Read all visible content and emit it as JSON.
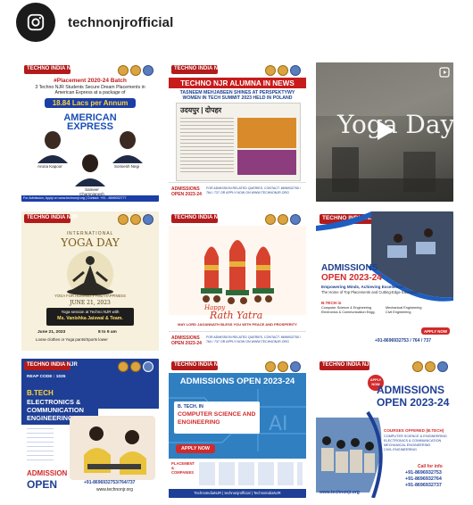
{
  "profile": {
    "handle": "technonjrofficial"
  },
  "posts": [
    {
      "id": "placement",
      "logo": "TECHNO INDIA NJR",
      "headline": "#Placement 2020-24 Batch",
      "subline": "3 Techno NJR Students Secure Dream Placements in American Express at a package of",
      "package": "18.84 Lacs per Annum",
      "company_line1": "AMERICAN",
      "company_line2": "EXPRESS",
      "students": [
        "Aruna Kapoor",
        "Somiesh Negi",
        "Sameer Chamnjanesh"
      ],
      "footer": "For Admission, Apply on www.technonjr.org | Contact: +91 - 8696932777"
    },
    {
      "id": "alumna-news",
      "logo": "TECHNO INDIA NJR",
      "banner": "TECHNO NJR ALUMNA IN NEWS",
      "headline": "TASNEEM MEHJABEEN SHINES AT PERSPEKTYWY WOMEN IN TECH SUMMIT 2023 HELD IN POLAND",
      "paper": "उदयपुर | दोपहर",
      "footer_left": "ADMISSIONS OPEN 2023-24",
      "footer_right": "FOR ADMISSION RELATED QUERIES, CONTACT: 8696932755 / 764 / 737 OR APPLY NOW ON WWW.TECHNONJR.ORG"
    },
    {
      "id": "yoga-video",
      "title": "Yoga Day"
    },
    {
      "id": "yoga-day",
      "logo": "TECHNO INDIA NJR",
      "title_top": "INTERNATIONAL",
      "title": "YOGA DAY",
      "tagline": "YOGA FOR HUMANITY AND HAPPINESS",
      "date_line": "JUNE 21, 2023",
      "session": "Yoga session at Techno NJR with",
      "instructor": "Ms. Vanishka Jaiswal & Team.",
      "date": "June 21, 2023",
      "time": "8 to 9 am",
      "dress": "Loose clothes or Yoga pants/Sports lower"
    },
    {
      "id": "rath-yatra",
      "logo": "TECHNO INDIA NJR",
      "greeting": "Happy",
      "title": "Rath Yatra",
      "wish": "MAY LORD JAGANNATH BLESS YOU WITH PEACE AND PROSPERITY",
      "footer_left": "ADMISSIONS OPEN 2023-24",
      "footer_right": "FOR ADMISSION RELATED QUERIES, CONTACT: 8696932755 / 764 / 737 OR APPLY NOW ON WWW.TECHNONJR.ORG"
    },
    {
      "id": "admissions-ee",
      "logo": "TECHNO INDIA NJR",
      "title1": "ADMISSIONS",
      "title2": "OPEN 2023-24",
      "tag": "Empowering Minds, Achieving Excellence:",
      "desc": "The Home of Top Placements and Cutting-Edge Education.",
      "courses_label": "B.TECH in",
      "course_a": "Computer Science & Engineering",
      "course_b": "Electronics & Communication Engg.",
      "course_c": "Mechanical Engineering",
      "course_d": "Civil Engineering",
      "apply": "APPLY NOW",
      "phone": "+91-8696932753 / 764 / 737"
    },
    {
      "id": "btech-ece",
      "logo": "TECHNO INDIA NJR",
      "reap": "REAP CODE : 1035",
      "btech": "B.TECH",
      "branch1": "ELECTRONICS &",
      "branch2": "COMMUNICATION",
      "branch3": "ENGINEERING",
      "admission1": "ADMISSION",
      "admission2": "OPEN",
      "phone": "+91-8696932753/764/737",
      "site": "www.technonjr.org"
    },
    {
      "id": "admissions-cse",
      "logo": "TECHNO INDIA NJR",
      "title": "ADMISSIONS OPEN 2023-24",
      "btech": "B. TECH. IN",
      "branch1": "COMPUTER SCIENCE AND",
      "branch2": "ENGINEERING",
      "apply": "APPLY NOW",
      "placement": "PLACEMENT & COMPANIES",
      "social": "TechnoIndiaNJR  |  technonjrofficial  |  TechnoIndiaNJR"
    },
    {
      "id": "admissions-courses",
      "logo": "TECHNO INDIA NJR",
      "apply": "APPLY NOW",
      "title1": "ADMISSIONS",
      "title2": "OPEN 2023-24",
      "courses_label": "COURSES OFFERED (B.TECH)",
      "courses": [
        "COMPUTER SCIENCE & ENGINEERING",
        "ELECTRONICS & COMMUNICATION",
        "MECHANICAL ENGINEERING",
        "CIVIL ENGINEERING"
      ],
      "call": "Call for info",
      "phones": [
        "+91-8696932753",
        "+91-8696932764",
        "+91-8696932737"
      ],
      "site": "www.technonjr.org"
    }
  ]
}
